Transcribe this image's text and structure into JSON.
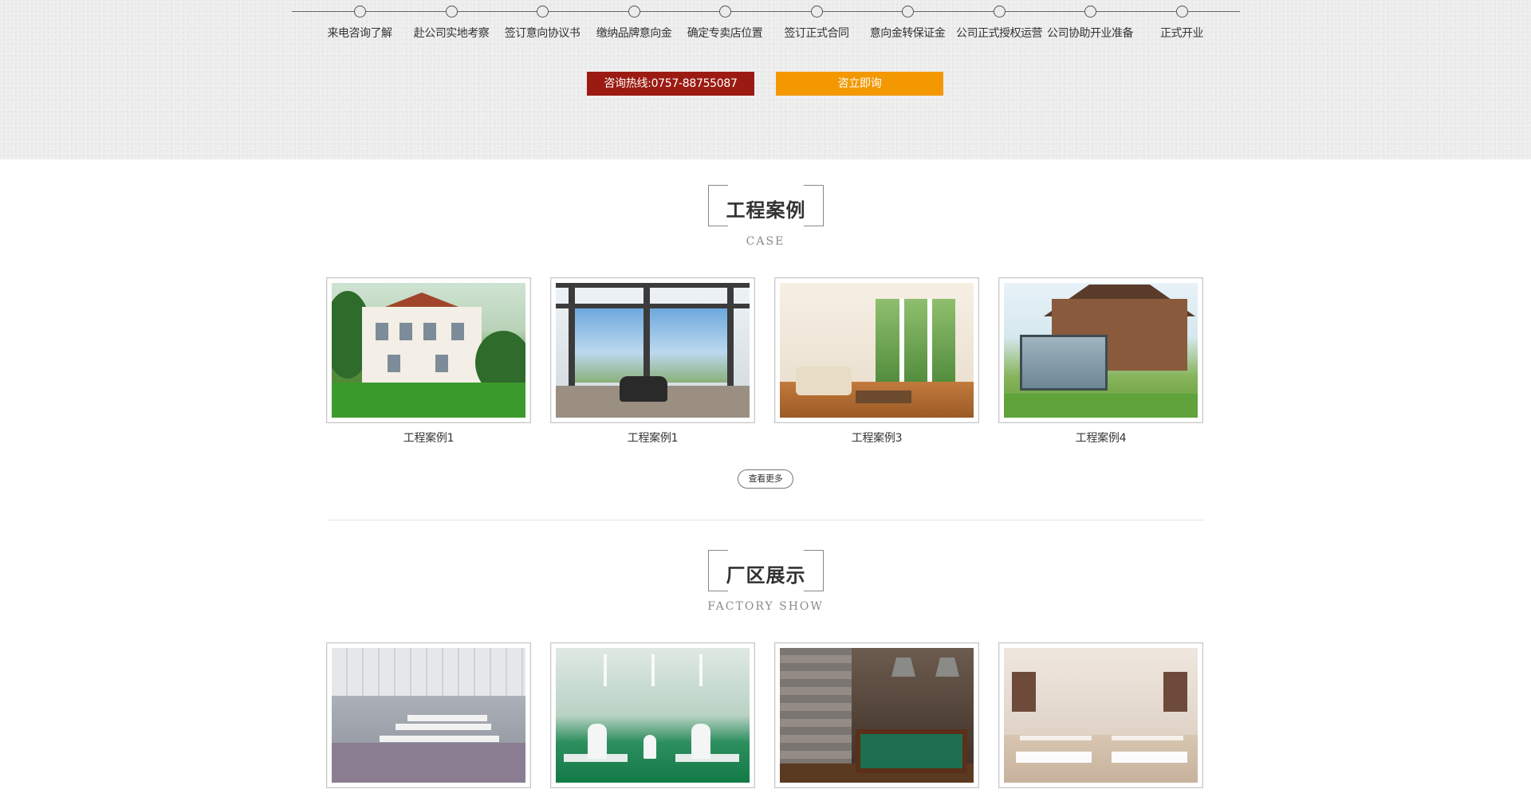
{
  "process_steps": [
    "来电咨询了解",
    "赴公司实地考察",
    "签订意向协议书",
    "缴纳品牌意向金",
    "确定专卖店位置",
    "签订正式合同",
    "意向金转保证金",
    "公司正式授权运营",
    "公司协助开业准备",
    "正式开业"
  ],
  "buttons": {
    "hotline": "咨询热线:0757-88755087",
    "consult": "咨立即询"
  },
  "cases": {
    "title": "工程案例",
    "subtitle": "CASE",
    "items": [
      {
        "caption": "工程案例1"
      },
      {
        "caption": "工程案例1"
      },
      {
        "caption": "工程案例3"
      },
      {
        "caption": "工程案例4"
      }
    ],
    "more_label": "查看更多"
  },
  "factory": {
    "title": "厂区展示",
    "subtitle": "FACTORY SHOW"
  },
  "colors": {
    "hotline_bg": "#9b1b12",
    "consult_bg": "#f39800",
    "band_bg": "#ececec"
  }
}
